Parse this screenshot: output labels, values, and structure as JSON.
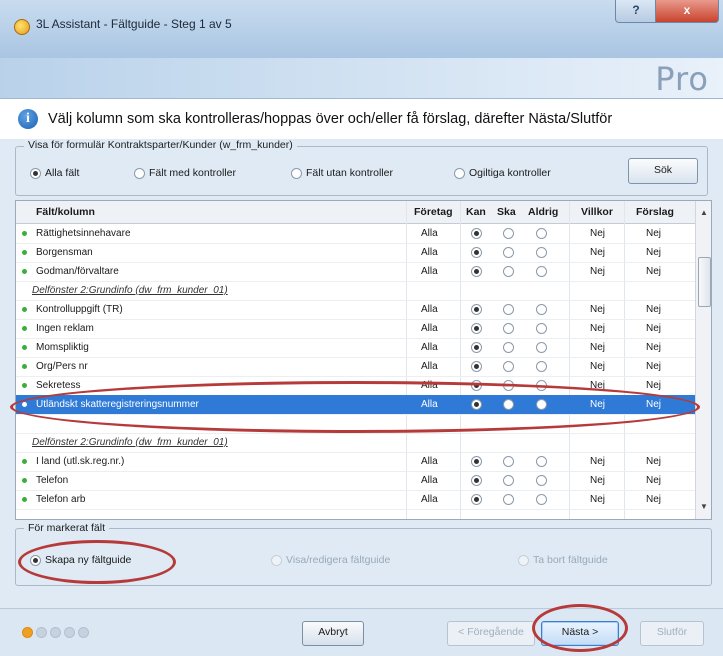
{
  "window": {
    "title": "3L Assistant - Fältguide - Steg 1 av 5",
    "help_label": "?",
    "close_label": "x"
  },
  "banner": {
    "logo_text": "Pro"
  },
  "info": {
    "icon": "info-icon",
    "message": "Välj kolumn som ska kontrolleras/hoppas över och/eller få förslag, därefter Nästa/Slutför"
  },
  "filter": {
    "legend": "Visa för formulär Kontraktsparter/Kunder (w_frm_kunder)",
    "options": [
      {
        "label": "Alla fält",
        "selected": true
      },
      {
        "label": "Fält med kontroller",
        "selected": false
      },
      {
        "label": "Fält utan kontroller",
        "selected": false
      },
      {
        "label": "Ogiltiga kontroller",
        "selected": false
      }
    ],
    "search_label": "Sök"
  },
  "grid": {
    "columns": [
      "Fält/kolumn",
      "Företag",
      "Kan",
      "Ska",
      "Aldrig",
      "Villkor",
      "Förslag"
    ],
    "rows": [
      {
        "type": "field",
        "name": "Rättighetsinnehavare",
        "foretag": "Alla",
        "choice": "kan",
        "villkor": "Nej",
        "forslag": "Nej"
      },
      {
        "type": "field",
        "name": "Borgensman",
        "foretag": "Alla",
        "choice": "kan",
        "villkor": "Nej",
        "forslag": "Nej"
      },
      {
        "type": "field",
        "name": "Godman/förvaltare",
        "foretag": "Alla",
        "choice": "kan",
        "villkor": "Nej",
        "forslag": "Nej"
      },
      {
        "type": "section",
        "name": "Delfönster 2:Grundinfo (dw_frm_kunder_01)"
      },
      {
        "type": "field",
        "name": "Kontrolluppgift (TR)",
        "foretag": "Alla",
        "choice": "kan",
        "villkor": "Nej",
        "forslag": "Nej"
      },
      {
        "type": "field",
        "name": "Ingen reklam",
        "foretag": "Alla",
        "choice": "kan",
        "villkor": "Nej",
        "forslag": "Nej"
      },
      {
        "type": "field",
        "name": "Momspliktig",
        "foretag": "Alla",
        "choice": "kan",
        "villkor": "Nej",
        "forslag": "Nej"
      },
      {
        "type": "field",
        "name": "Org/Pers nr",
        "foretag": "Alla",
        "choice": "kan",
        "villkor": "Nej",
        "forslag": "Nej"
      },
      {
        "type": "field",
        "name": "Sekretess",
        "foretag": "Alla",
        "choice": "kan",
        "villkor": "Nej",
        "forslag": "Nej"
      },
      {
        "type": "field",
        "name": "Utländskt skatteregistreringsnummer",
        "foretag": "Alla",
        "choice": "kan",
        "villkor": "Nej",
        "forslag": "Nej",
        "selected": true
      },
      {
        "type": "blank",
        "name": ""
      },
      {
        "type": "section",
        "name": "Delfönster 2:Grundinfo (dw_frm_kunder_01)"
      },
      {
        "type": "field",
        "name": "I land (utl.sk.reg.nr.)",
        "foretag": "Alla",
        "choice": "kan",
        "villkor": "Nej",
        "forslag": "Nej"
      },
      {
        "type": "field",
        "name": "Telefon",
        "foretag": "Alla",
        "choice": "kan",
        "villkor": "Nej",
        "forslag": "Nej"
      },
      {
        "type": "field",
        "name": "Telefon arb",
        "foretag": "Alla",
        "choice": "kan",
        "villkor": "Nej",
        "forslag": "Nej"
      }
    ]
  },
  "marked": {
    "legend": "För markerat fält",
    "options": [
      {
        "label": "Skapa ny fältguide",
        "enabled": true,
        "selected": true
      },
      {
        "label": "Visa/redigera fältguide",
        "enabled": false,
        "selected": false
      },
      {
        "label": "Ta bort fältguide",
        "enabled": false,
        "selected": false
      }
    ]
  },
  "footer": {
    "progress": {
      "current_step": 1,
      "total_steps": 5
    },
    "cancel_label": "Avbryt",
    "prev_label": "< Föregående",
    "next_label": "Nästa >",
    "finish_label": "Slutför"
  },
  "colors": {
    "accent_red": "#b73a3a",
    "selection_blue": "#2f7ad6",
    "progress_orange": "#f0a020"
  }
}
